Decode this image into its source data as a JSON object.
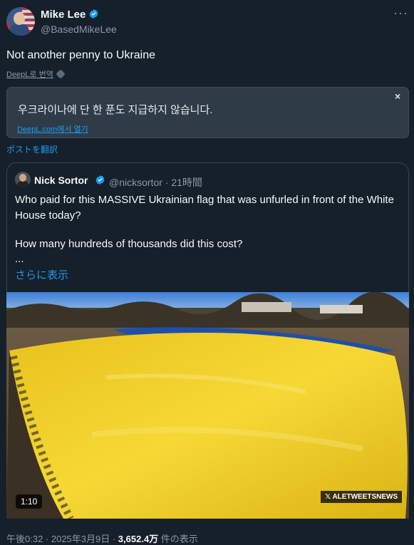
{
  "post": {
    "author_name": "Mike Lee",
    "author_handle": "@BasedMikeLee",
    "text": "Not another penny to Ukraine",
    "deepl_link": "DeepL로 번역",
    "translation": {
      "text": "우크라이나에 단 한 푼도 지급하지 않습니다.",
      "open_link": "DeepL.com에서 열기",
      "close": "×"
    },
    "translate_post": "ポストを翻訳",
    "more": "···"
  },
  "quote": {
    "author_name": "Nick Sortor",
    "author_handle": "@nicksortor · 21時間",
    "text_line1": "Who paid for this MASSIVE Ukrainian flag that was unfurled in front of the White House today?",
    "text_line2": "How many hundreds of thousands did this cost?",
    "ellipsis": "...",
    "show_more": "さらに表示",
    "video_duration": "1:10",
    "watermark": "𝕏 ALETWEETSNEWS"
  },
  "footer": {
    "time": "午後0:32 · 2025年3月9日 · ",
    "views": "3,652.4万",
    "views_label": " 件の表示"
  },
  "colors": {
    "background": "#15202b",
    "accent": "#1d9bf0",
    "flag_yellow": "#f2cd2e",
    "flag_blue": "#1f4fa8"
  }
}
